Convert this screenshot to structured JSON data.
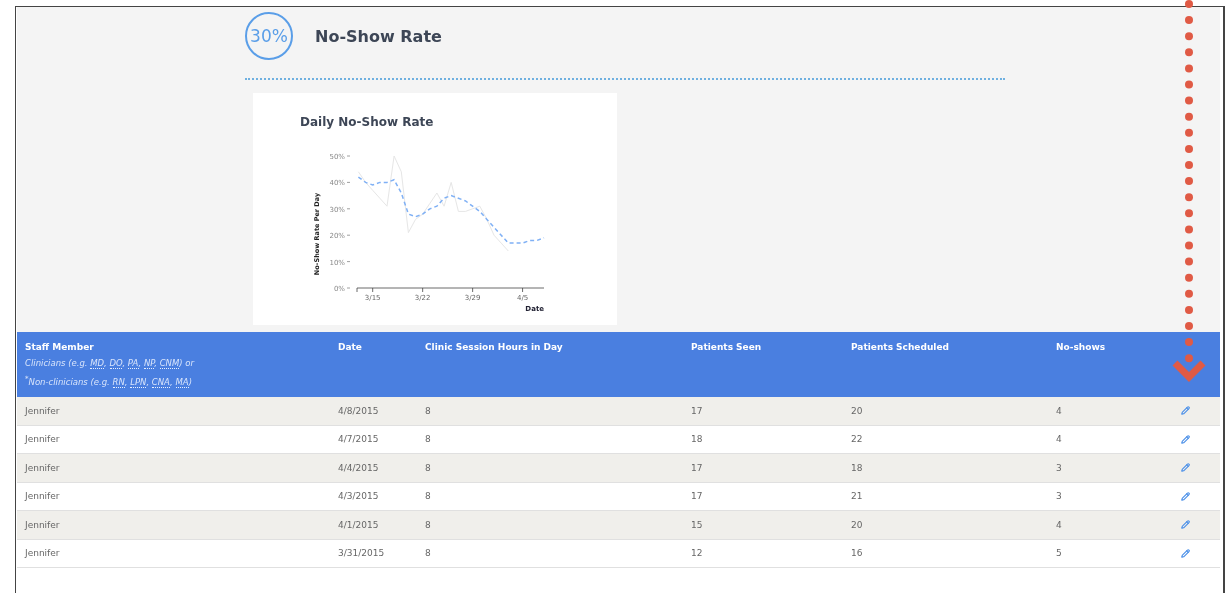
{
  "summary": {
    "percent": "30%",
    "title": "No-Show Rate"
  },
  "chart": {
    "chart_data": {
      "type": "line",
      "title": "Daily No-Show Rate",
      "xlabel": "Date",
      "ylabel": "No-Show Rate Per Day",
      "categories": [
        null,
        null,
        "3/15",
        null,
        null,
        null,
        null,
        null,
        null,
        "3/22",
        null,
        null,
        null,
        null,
        null,
        null,
        "3/29",
        null,
        null,
        null,
        null,
        null,
        null,
        "4/5",
        null,
        null,
        null
      ],
      "series": [
        {
          "color": "#e6e6e6",
          "values": [
            44,
            40,
            37,
            34,
            31,
            50,
            44,
            21,
            26,
            28,
            32,
            36,
            31,
            40,
            29,
            29,
            30,
            31,
            26,
            20,
            17,
            14,
            null,
            null,
            null,
            null,
            null
          ]
        },
        {
          "color": "#7fb0f5",
          "line_style": "dashed",
          "values": [
            42,
            40,
            39,
            40,
            40,
            41,
            36,
            28,
            27,
            28,
            30,
            31,
            34,
            35,
            34,
            33,
            31,
            29,
            26,
            23,
            20,
            17,
            17,
            17,
            18,
            18,
            19
          ]
        }
      ],
      "ylim": [
        0,
        50
      ],
      "yticks": [
        {
          "value": 0,
          "label": "0%"
        },
        {
          "value": 10,
          "label": "10%"
        },
        {
          "value": 20,
          "label": "20%"
        },
        {
          "value": 30,
          "label": "30%"
        },
        {
          "value": 40,
          "label": "40%"
        },
        {
          "value": 50,
          "label": "50%"
        }
      ]
    }
  },
  "table": {
    "columns": [
      {
        "title": "Staff Member",
        "notes": [
          [
            {
              "kind": "text",
              "text": "Clinicians (e.g. "
            },
            {
              "kind": "abbr",
              "text": "MD"
            },
            {
              "kind": "text",
              "text": ", "
            },
            {
              "kind": "abbr",
              "text": "DO"
            },
            {
              "kind": "text",
              "text": ", "
            },
            {
              "kind": "abbr",
              "text": "PA"
            },
            {
              "kind": "text",
              "text": ", "
            },
            {
              "kind": "abbr",
              "text": "NP"
            },
            {
              "kind": "text",
              "text": ", "
            },
            {
              "kind": "abbr",
              "text": "CNM"
            },
            {
              "kind": "text",
              "text": ") or"
            }
          ],
          [
            {
              "kind": "text",
              "text": "$^{*}$Non-clinicians (e.g. "
            },
            {
              "kind": "abbr",
              "text": "RN"
            },
            {
              "kind": "text",
              "text": ", "
            },
            {
              "kind": "abbr",
              "text": "LPN"
            },
            {
              "kind": "text",
              "text": ", "
            },
            {
              "kind": "abbr",
              "text": "CNA"
            },
            {
              "kind": "text",
              "text": ", "
            },
            {
              "kind": "abbr",
              "text": "MA"
            },
            {
              "kind": "text",
              "text": ")"
            }
          ]
        ]
      },
      {
        "title": "Date"
      },
      {
        "title": "Clinic Session Hours in Day"
      },
      {
        "title": "Patients Seen"
      },
      {
        "title": "Patients Scheduled"
      },
      {
        "title": "No-shows"
      }
    ],
    "rows": [
      {
        "cells": [
          "Jennifer",
          "4/8/2015",
          "8",
          "17",
          "20",
          "4"
        ]
      },
      {
        "cells": [
          "Jennifer",
          "4/7/2015",
          "8",
          "18",
          "22",
          "4"
        ]
      },
      {
        "cells": [
          "Jennifer",
          "4/4/2015",
          "8",
          "17",
          "18",
          "3"
        ]
      },
      {
        "cells": [
          "Jennifer",
          "4/3/2015",
          "8",
          "17",
          "21",
          "3"
        ]
      },
      {
        "cells": [
          "Jennifer",
          "4/1/2015",
          "8",
          "15",
          "20",
          "4"
        ]
      },
      {
        "cells": [
          "Jennifer",
          "3/31/2015",
          "8",
          "12",
          "16",
          "5"
        ]
      }
    ]
  }
}
